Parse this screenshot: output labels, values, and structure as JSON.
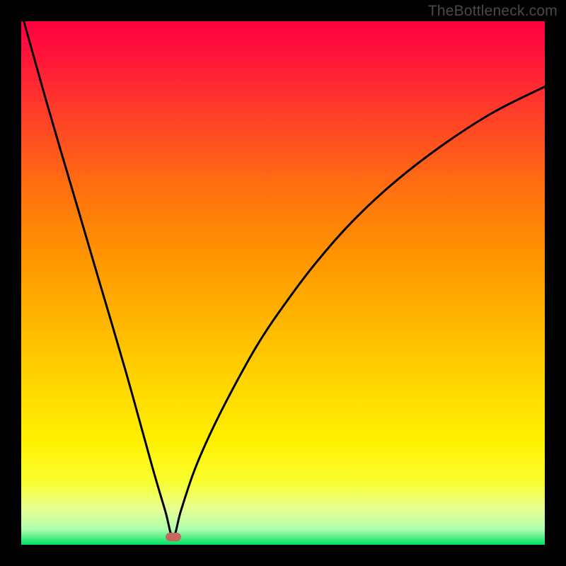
{
  "watermark": "TheBottleneck.com",
  "frame": {
    "border_color": "#000000",
    "border_px": 30
  },
  "marker": {
    "x_pct": 0.29,
    "y_pct": 0.985,
    "color": "#c66860"
  },
  "chart_data": {
    "type": "line",
    "title": "",
    "xlabel": "",
    "ylabel": "",
    "xlim": [
      0,
      1
    ],
    "ylim": [
      0,
      1
    ],
    "note": "Axes are unlabeled; x and y are normalized plot-area fractions (0=left/top of plot, 1=right/bottom). The curve is a V-shaped bottleneck: a steep near-linear left branch descending to a minimum near x≈0.29, then a concave right branch rising toward the top-right.",
    "series": [
      {
        "name": "bottleneck-curve",
        "x": [
          0.005,
          0.05,
          0.1,
          0.15,
          0.2,
          0.25,
          0.275,
          0.29,
          0.305,
          0.33,
          0.36,
          0.4,
          0.45,
          0.5,
          0.56,
          0.63,
          0.71,
          0.8,
          0.9,
          1.0
        ],
        "y": [
          0.0,
          0.16,
          0.33,
          0.5,
          0.67,
          0.85,
          0.935,
          0.985,
          0.935,
          0.86,
          0.79,
          0.71,
          0.62,
          0.545,
          0.465,
          0.385,
          0.31,
          0.24,
          0.175,
          0.125
        ],
        "minimum": {
          "x": 0.29,
          "y": 0.985
        }
      }
    ],
    "background_gradient": {
      "direction": "vertical",
      "stops": [
        {
          "at": 0.0,
          "color": "#ff0040"
        },
        {
          "at": 0.45,
          "color": "#ff9500"
        },
        {
          "at": 0.8,
          "color": "#fff000"
        },
        {
          "at": 1.0,
          "color": "#00e060"
        }
      ]
    }
  }
}
